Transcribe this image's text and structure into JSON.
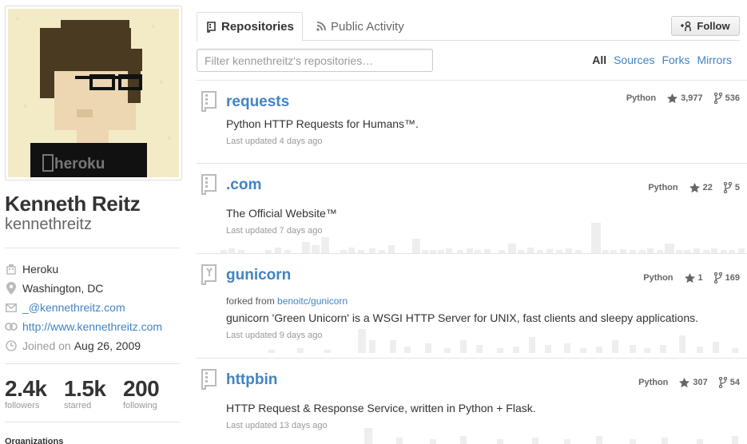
{
  "profile": {
    "fullname": "Kenneth Reitz",
    "username": "kennethreitz",
    "company": "Heroku",
    "location": "Washington, DC",
    "email": "_@kennethreitz.com",
    "website": "http://www.kennethreitz.com",
    "joined_label": "Joined on",
    "joined_date": "Aug 26, 2009",
    "avatar_badge": "heroku",
    "stats": [
      {
        "value": "2.4k",
        "label": "followers"
      },
      {
        "value": "1.5k",
        "label": "starred"
      },
      {
        "value": "200",
        "label": "following"
      }
    ],
    "orgs_label": "Organizations"
  },
  "tabs": [
    {
      "label": "Repositories",
      "icon": "repo-icon"
    },
    {
      "label": "Public Activity",
      "icon": "rss-icon"
    }
  ],
  "follow_label": "Follow",
  "filter": {
    "placeholder": "Filter kennethreitz's repositories…",
    "links": [
      "All",
      "Sources",
      "Forks",
      "Mirrors"
    ]
  },
  "repos": [
    {
      "name": "requests",
      "description": "Python HTTP Requests for Humans™.",
      "updated": "Last updated 4 days ago",
      "language": "Python",
      "stars": "3,977",
      "forks": "536",
      "forked_from": null,
      "icon": "repo-icon"
    },
    {
      "name": ".com",
      "description": "The Official Website™",
      "updated": "Last updated 7 days ago",
      "language": "Python",
      "stars": "22",
      "forks": "5",
      "forked_from": null,
      "icon": "repo-icon"
    },
    {
      "name": "gunicorn",
      "description": "gunicorn 'Green Unicorn' is a WSGI HTTP Server for UNIX, fast clients and sleepy applications.",
      "updated": "Last updated 9 days ago",
      "language": "Python",
      "stars": "1",
      "forks": "169",
      "forked_from_label": "forked from",
      "forked_from": "benoitc/gunicorn",
      "icon": "fork-repo-icon"
    },
    {
      "name": "httpbin",
      "description": "HTTP Request & Response Service, written in Python + Flask.",
      "updated": "Last updated 13 days ago",
      "language": "Python",
      "stars": "307",
      "forks": "54",
      "forked_from": null,
      "icon": "repo-icon"
    }
  ],
  "colors": {
    "link": "#4183c4",
    "graph": "#eeeeee",
    "muted": "#999999"
  }
}
